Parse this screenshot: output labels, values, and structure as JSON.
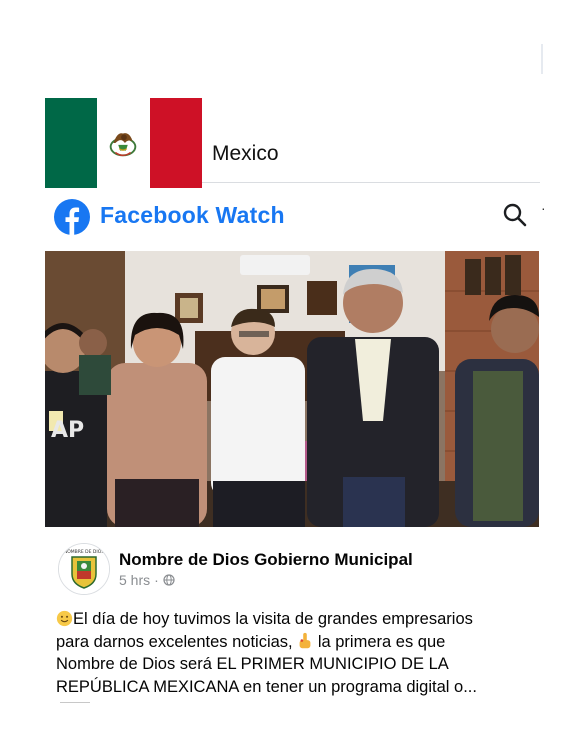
{
  "header": {
    "country_name": "Mexico",
    "flag_colors": {
      "green": "#006847",
      "white": "#ffffff",
      "red": "#ce1126"
    },
    "flag_emblem": "eagle-emblem-icon"
  },
  "watch_bar": {
    "logo_icon": "facebook-logo-icon",
    "title": "Facebook Watch",
    "title_color": "#1877f2",
    "search_icon": "search-icon"
  },
  "video": {
    "thumbnail": "group-photo-five-people-standing-in-office"
  },
  "post": {
    "page_name": "Nombre de Dios Gobierno Municipal",
    "time": "5 hrs",
    "separator": "·",
    "audience_icon": "globe-icon",
    "avatar_icon": "municipal-crest-icon",
    "text_line1": "El día de hoy tuvimos la visita de grandes empresarios",
    "text_line2": "para darnos excelentes noticias,",
    "text_line2b": "la primera es que",
    "text_line3": "Nombre de Dios será EL PRIMER MUNICIPIO DE LA",
    "text_line4": "REPÚBLICA MEXICANA en tener un programa digital o...",
    "emoji_start": "smiling-face-emoji",
    "emoji_point": "pointing-finger-emoji"
  }
}
